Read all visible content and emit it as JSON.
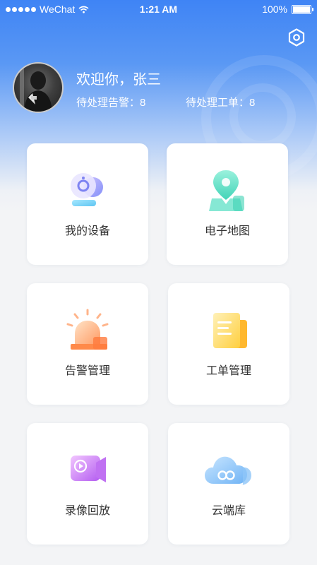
{
  "status_bar": {
    "carrier": "WeChat",
    "time": "1:21 AM",
    "battery": "100%"
  },
  "header": {
    "welcome": "欢迎你，张三",
    "alarm_pending": "待处理告警：8",
    "ticket_pending": "待处理工单：8"
  },
  "menu": [
    {
      "label": "我的设备",
      "icon": "camera-device-icon"
    },
    {
      "label": "电子地图",
      "icon": "map-pin-icon"
    },
    {
      "label": "告警管理",
      "icon": "alarm-siren-icon"
    },
    {
      "label": "工单管理",
      "icon": "work-order-icon"
    },
    {
      "label": "录像回放",
      "icon": "video-replay-icon"
    },
    {
      "label": "云端库",
      "icon": "cloud-storage-icon"
    }
  ],
  "colors": {
    "header_gradient_top": "#3f84f5",
    "background": "#f3f4f6",
    "card": "#ffffff",
    "text": "#333333"
  }
}
